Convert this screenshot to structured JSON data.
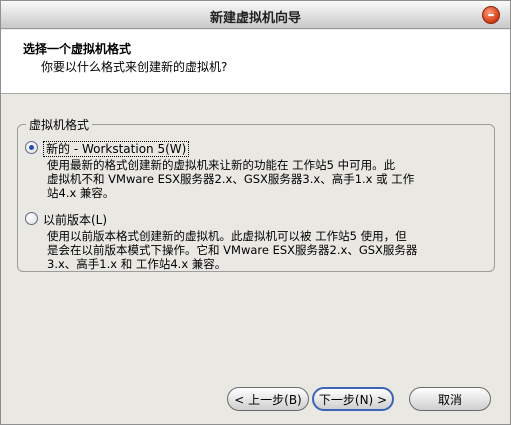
{
  "window": {
    "title": "新建虚拟机向导"
  },
  "header": {
    "title": "选择一个虚拟机格式",
    "subtitle": "你要以什么格式来创建新的虚拟机?"
  },
  "format_group": {
    "legend": "虚拟机格式",
    "options": [
      {
        "label": "新的 - Workstation 5(W)",
        "checked": true,
        "desc_lines": [
          "使用最新的格式创建新的虚拟机来让新的功能在 工作站5 中可用。此",
          "虚拟机不和 VMware ESX服务器2.x、GSX服务器3.x、高手1.x 或 工作",
          "站4.x 兼容。"
        ]
      },
      {
        "label": "以前版本(L)",
        "checked": false,
        "desc_lines": [
          "使用以前版本格式创建新的虚拟机。此虚拟机可以被 工作站5 使用，但",
          "是会在以前版本模式下操作。它和 VMware ESX服务器2.x、GSX服务器",
          "3.x、高手1.x 和 工作站4.x 兼容。"
        ]
      }
    ]
  },
  "buttons": {
    "back": "< 上一步(B)",
    "next": "下一步(N) >",
    "cancel": "取消"
  }
}
